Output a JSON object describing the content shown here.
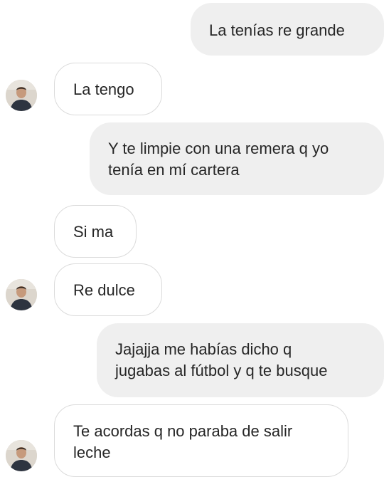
{
  "messages": [
    {
      "from": "me",
      "text": "La tenías re grande"
    },
    {
      "from": "them",
      "text": "La tengo"
    },
    {
      "from": "me",
      "lines": [
        "Y te limpie con una remera q yo",
        "tenía en mí cartera"
      ]
    },
    {
      "from": "them",
      "text": "Si ma"
    },
    {
      "from": "them",
      "text": "Re dulce"
    },
    {
      "from": "me",
      "lines": [
        "Jajajja me habías dicho q",
        "jugabas al fútbol y q te busque"
      ]
    },
    {
      "from": "them",
      "lines": [
        "Te acordas q no paraba de salir",
        "leche"
      ]
    }
  ],
  "colors": {
    "sent_bubble": "#efefef",
    "received_border": "#dbdbdb",
    "text": "#262626",
    "background": "#ffffff"
  },
  "icons": {
    "avatar": "contact-avatar"
  }
}
